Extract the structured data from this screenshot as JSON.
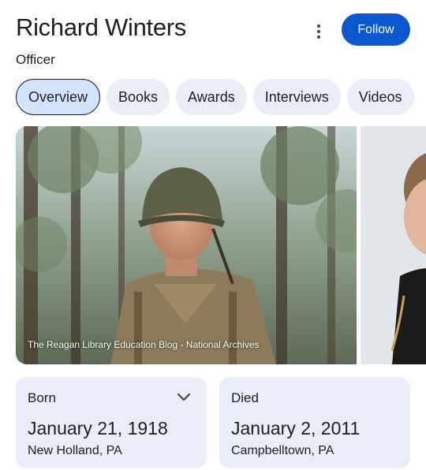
{
  "header": {
    "title": "Richard Winters",
    "subtitle": "Officer",
    "more_icon": "more-vert-icon",
    "follow_label": "Follow"
  },
  "tabs": [
    {
      "label": "Overview",
      "active": true
    },
    {
      "label": "Books",
      "active": false
    },
    {
      "label": "Awards",
      "active": false
    },
    {
      "label": "Interviews",
      "active": false
    },
    {
      "label": "Videos",
      "active": false
    }
  ],
  "media": {
    "caption": "The Reagan Library Education Blog - National Archives"
  },
  "cards": {
    "born": {
      "label": "Born",
      "date": "January 21, 1918",
      "place": "New Holland, PA",
      "expand_icon": "chevron-down-icon"
    },
    "died": {
      "label": "Died",
      "date": "January 2, 2011",
      "place": "Campbelltown, PA"
    }
  },
  "colors": {
    "accent": "#0b57d0",
    "chip_bg": "#e8edf8",
    "chip_active_bg": "#d3e3fd",
    "text": "#1f1f1f"
  }
}
